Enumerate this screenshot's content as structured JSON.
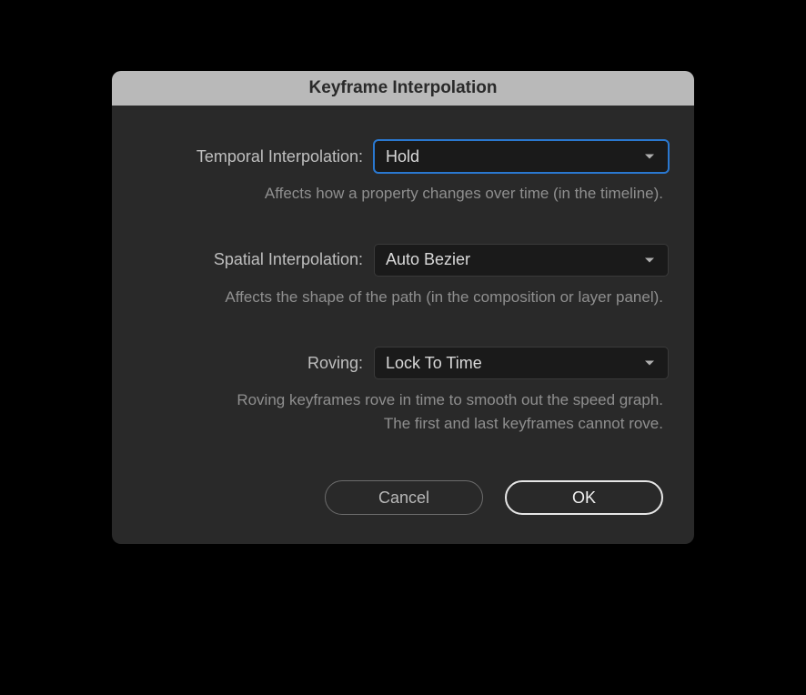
{
  "dialog": {
    "title": "Keyframe Interpolation"
  },
  "fields": {
    "temporal": {
      "label": "Temporal Interpolation:",
      "value": "Hold",
      "description": "Affects how a property changes over time (in the timeline)."
    },
    "spatial": {
      "label": "Spatial Interpolation:",
      "value": "Auto Bezier",
      "description": "Affects the shape of the path (in the composition or layer panel)."
    },
    "roving": {
      "label": "Roving:",
      "value": "Lock To Time",
      "description": "Roving keyframes rove in time to smooth out the speed graph.\nThe first and last keyframes cannot rove."
    }
  },
  "buttons": {
    "cancel": "Cancel",
    "ok": "OK"
  }
}
